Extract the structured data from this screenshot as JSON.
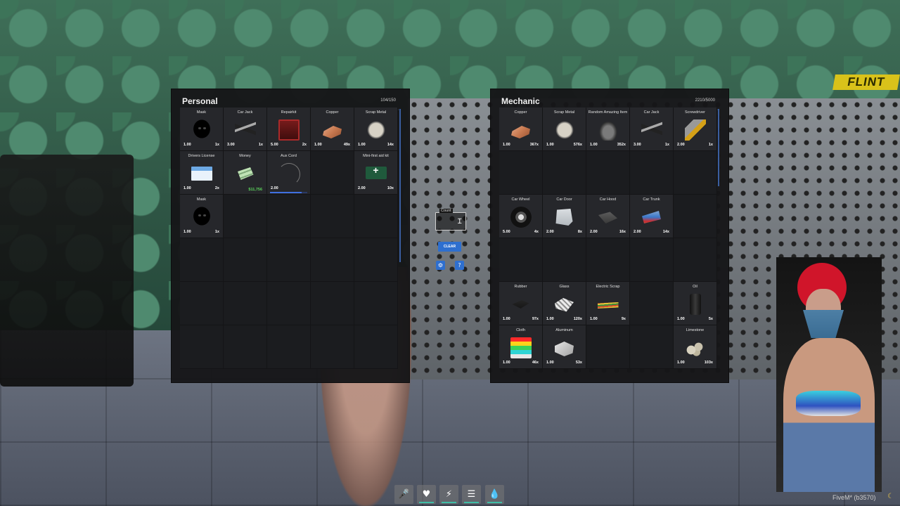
{
  "personal": {
    "title": "Personal",
    "weight": "104/150",
    "weight_fraction": 0.69,
    "slots": [
      {
        "label": "Mask",
        "weight": "1.00",
        "count": "1x",
        "icon": "mask-icon"
      },
      {
        "label": "Car Jack",
        "weight": "3.00",
        "count": "1x",
        "icon": "car-jack-icon"
      },
      {
        "label": "Repairkit",
        "weight": "5.00",
        "count": "2x",
        "icon": "repair-kit-icon"
      },
      {
        "label": "Copper",
        "weight": "1.00",
        "count": "49x",
        "icon": "copper-icon"
      },
      {
        "label": "Scrap Metal",
        "weight": "1.00",
        "count": "14x",
        "icon": "scrap-metal-icon"
      },
      {
        "label": "Drivers License",
        "weight": "1.00",
        "count": "2x",
        "icon": "license-icon"
      },
      {
        "label": "Money",
        "weight": "",
        "count": "",
        "money": "$11,756",
        "icon": "money-icon"
      },
      {
        "label": "Aux Cord",
        "weight": "2.00",
        "count": "",
        "durability": 0.85,
        "icon": "cord-icon"
      },
      null,
      {
        "label": "Mini-first aid kit",
        "weight": "2.00",
        "count": "10x",
        "icon": "first-aid-icon"
      },
      {
        "label": "Mask",
        "weight": "1.00",
        "count": "1x",
        "icon": "mask-icon"
      },
      null,
      null,
      null,
      null,
      null,
      null,
      null,
      null,
      null,
      null,
      null,
      null,
      null,
      null,
      null,
      null,
      null,
      null,
      null
    ]
  },
  "mechanic": {
    "title": "Mechanic",
    "weight": "2210/5000",
    "weight_fraction": 0.44,
    "slots": [
      {
        "label": "Copper",
        "weight": "1.00",
        "count": "367x",
        "icon": "copper-icon"
      },
      {
        "label": "Scrap Metal",
        "weight": "1.00",
        "count": "576x",
        "icon": "scrap-metal-icon"
      },
      {
        "label": "Random Amazing Item",
        "weight": "1.00",
        "count": "352x",
        "icon": "bag-icon"
      },
      {
        "label": "Car Jack",
        "weight": "3.00",
        "count": "1x",
        "icon": "car-jack-icon"
      },
      {
        "label": "Screwdriver",
        "weight": "2.00",
        "count": "1x",
        "icon": "screwdriver-icon"
      },
      null,
      null,
      null,
      null,
      null,
      {
        "label": "Car Wheel",
        "weight": "5.00",
        "count": "4x",
        "icon": "car-wheel-icon"
      },
      {
        "label": "Car Door",
        "weight": "2.00",
        "count": "8x",
        "icon": "car-door-icon"
      },
      {
        "label": "Car Hood",
        "weight": "2.00",
        "count": "16x",
        "icon": "car-hood-icon"
      },
      {
        "label": "Car Trunk",
        "weight": "2.00",
        "count": "14x",
        "icon": "car-trunk-icon"
      },
      null,
      null,
      null,
      null,
      null,
      null,
      {
        "label": "Rubber",
        "weight": "1.00",
        "count": "97x",
        "icon": "rubber-icon"
      },
      {
        "label": "Glass",
        "weight": "1.00",
        "count": "120x",
        "icon": "glass-icon"
      },
      {
        "label": "Electric Scrap",
        "weight": "1.00",
        "count": "9x",
        "icon": "electric-scrap-icon"
      },
      null,
      {
        "label": "Oil",
        "weight": "1.00",
        "count": "5x",
        "icon": "oil-icon"
      },
      {
        "label": "Cloth",
        "weight": "1.00",
        "count": "46x",
        "icon": "cloth-icon"
      },
      {
        "label": "Aluminum",
        "weight": "1.00",
        "count": "53x",
        "icon": "aluminum-icon"
      },
      null,
      null,
      {
        "label": "Limestone",
        "weight": "1.00",
        "count": "103x",
        "icon": "limestone-icon"
      }
    ]
  },
  "controls": {
    "count_label": "Count",
    "count_value": "",
    "clear_label": "CLEAR",
    "settings_icon": "gear-icon",
    "help_icon": "question-icon"
  },
  "hotbar": [
    {
      "icon": "microphone-icon",
      "glyph": "🎤",
      "status": false
    },
    {
      "icon": "heart-icon",
      "glyph": "♥",
      "status": true
    },
    {
      "icon": "lightning-icon",
      "glyph": "⚡",
      "status": true
    },
    {
      "icon": "armor-icon",
      "glyph": "☰",
      "status": true
    },
    {
      "icon": "water-drop-icon",
      "glyph": "💧",
      "status": true
    }
  ],
  "fivem_label": "FiveM* (b3570)",
  "colors": {
    "accent": "#2e6fcf",
    "weight_bar": "#3f87d6",
    "money": "#5bd35b",
    "hud_bar": "#3fbda6"
  }
}
